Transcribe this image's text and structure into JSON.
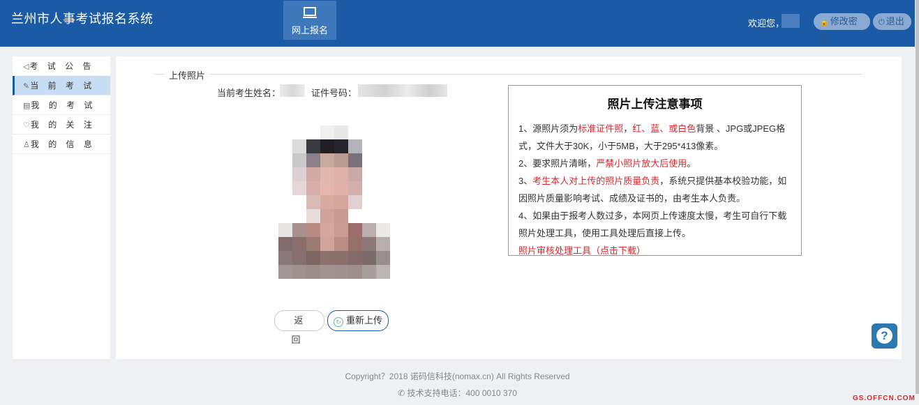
{
  "header": {
    "site_title": "兰州市人事考试报名系统",
    "nav_tab_label": "网上报名",
    "welcome": "欢迎您，",
    "change_password": "修改密码",
    "logout": "退出"
  },
  "sidebar": {
    "items": [
      {
        "label": "考 试 公 告",
        "icon": "megaphone-icon",
        "active": false
      },
      {
        "label": "当 前 考 试",
        "icon": "edit-icon",
        "active": true
      },
      {
        "label": "我 的 考 试",
        "icon": "document-icon",
        "active": false
      },
      {
        "label": "我 的 关 注",
        "icon": "heart-icon",
        "active": false
      },
      {
        "label": "我 的 信 息",
        "icon": "user-icon",
        "active": false
      }
    ]
  },
  "main": {
    "section_title": "上传照片",
    "candidate_name_label": "当前考生姓名：",
    "id_number_label": "证件号码：",
    "back_button": "返　回",
    "reupload_button": "重新上传"
  },
  "notice": {
    "title": "照片上传注意事项",
    "item1_a": "1、源照片须为",
    "item1_b": "标准证件照",
    "item1_c": "，",
    "item1_d": "红、蓝、或白色",
    "item1_e": "背景 、JPG或JPEG格式，文件大于30K，小于5MB，大于295*413像素。",
    "item2_a": "2、要求照片清晰，",
    "item2_b": "严禁小照片放大后使用",
    "item2_c": "。",
    "item3_a": "3、",
    "item3_b": "考生本人对上传的照片质量负责",
    "item3_c": "，系统只提供基本校验功能，如因照片质量影响考试、成绩及证书的，由考生本人负责。",
    "item4": "4、如果由于报考人数过多，本网页上传速度太慢，考生可自行下载照片处理工具，使用工具处理后直接上传。",
    "tool_link": "照片审核处理工具（点击下载）"
  },
  "footer": {
    "copyright": "Copyright？2018 诺码信科技(nomax.cn) All Rights Reserved",
    "support": "技术支持电话：400 0010 370"
  },
  "watermark": "GS.OFFCN.COM",
  "colors": {
    "header_bg": "#1b5ba6",
    "accent_red": "#e0262c",
    "active_item_bg": "#c7ddf3"
  }
}
